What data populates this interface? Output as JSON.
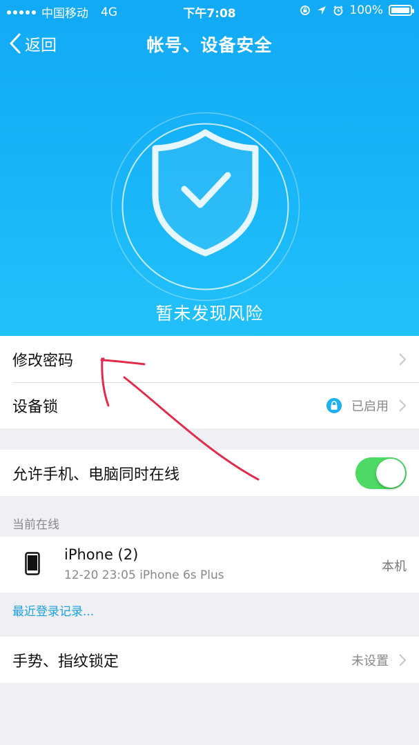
{
  "status_bar": {
    "carrier": "中国移动",
    "network": "4G",
    "time": "下午7:08",
    "battery": "100%",
    "battery_level": 1.0
  },
  "nav": {
    "back_label": "返回",
    "title": "帐号、设备安全"
  },
  "hero": {
    "status_text": "暂未发现风险",
    "icon": "shield-check-icon"
  },
  "settings": {
    "change_password": "修改密码",
    "device_lock": "设备锁",
    "device_lock_status": "已启用",
    "allow_simultaneous": "允许手机、电脑同时在线",
    "allow_simultaneous_on": true
  },
  "online": {
    "section_title": "当前在线",
    "devices": [
      {
        "name": "iPhone (2)",
        "meta": "12-20 23:05  iPhone 6s Plus",
        "tag": "本机"
      }
    ],
    "recent_login_link": "最近登录记录..."
  },
  "gesture": {
    "label": "手势、指纹锁定",
    "status": "未设置"
  },
  "colors": {
    "hero_blue": "#17b3f7",
    "toggle_green": "#4cd964",
    "link_blue": "#1aa1e6",
    "annotation_red": "#e02c4a"
  }
}
